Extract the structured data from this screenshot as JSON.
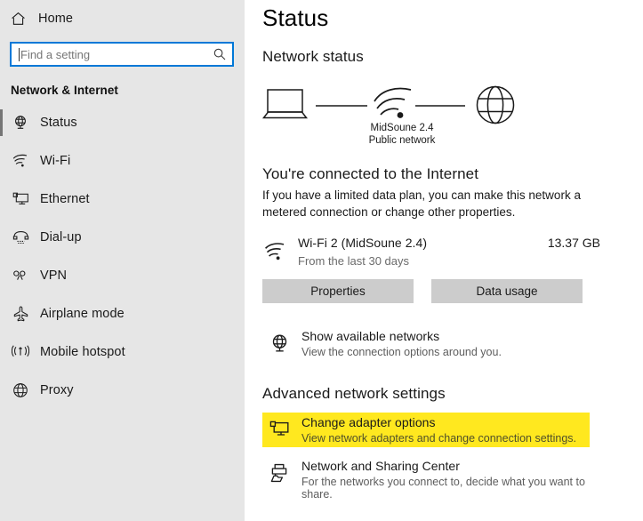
{
  "sidebar": {
    "home": {
      "label": "Home",
      "icon": "home-icon"
    },
    "search": {
      "value": "",
      "placeholder": "Find a setting",
      "icon": "search-icon"
    },
    "category_title": "Network & Internet",
    "items": [
      {
        "label": "Status",
        "icon": "globe-stand-icon",
        "selected": true
      },
      {
        "label": "Wi-Fi",
        "icon": "wifi-icon",
        "selected": false
      },
      {
        "label": "Ethernet",
        "icon": "monitor-icon",
        "selected": false
      },
      {
        "label": "Dial-up",
        "icon": "phone-handset-icon",
        "selected": false
      },
      {
        "label": "VPN",
        "icon": "vpn-key-icon",
        "selected": false
      },
      {
        "label": "Airplane mode",
        "icon": "airplane-icon",
        "selected": false
      },
      {
        "label": "Mobile hotspot",
        "icon": "broadcast-icon",
        "selected": false
      },
      {
        "label": "Proxy",
        "icon": "globe-icon",
        "selected": false
      }
    ]
  },
  "main": {
    "page_title": "Status",
    "network_status_heading": "Network status",
    "diagram": {
      "device_icon": "laptop-icon",
      "link_icon": "wifi-icon",
      "internet_icon": "globe-icon",
      "network_name": "MidSoune 2.4",
      "network_type": "Public network"
    },
    "connection": {
      "heading": "You're connected to the Internet",
      "description": "If you have a limited data plan, you can make this network a metered connection or change other properties."
    },
    "adapter": {
      "icon": "wifi-icon",
      "name": "Wi-Fi 2 (MidSoune 2.4)",
      "subtitle": "From the last 30 days",
      "data_usage": "13.37 GB"
    },
    "buttons": {
      "properties": "Properties",
      "data_usage": "Data usage"
    },
    "show_networks": {
      "icon": "globe-stand-icon",
      "title": "Show available networks",
      "subtitle": "View the connection options around you."
    },
    "advanced_heading": "Advanced network settings",
    "advanced_links": [
      {
        "icon": "monitor-icon",
        "title": "Change adapter options",
        "subtitle": "View network adapters and change connection settings.",
        "highlighted": true
      },
      {
        "icon": "share-icon",
        "title": "Network and Sharing Center",
        "subtitle": "For the networks you connect to, decide what you want to share.",
        "highlighted": false
      }
    ]
  },
  "colors": {
    "sidebar_background": "#E6E6E6",
    "main_background": "#FFFFFF",
    "accent_focus": "#0078D7",
    "button_background": "#CCCCCC",
    "highlight_yellow": "#FFE81F",
    "selection_indicator": "#767676"
  }
}
